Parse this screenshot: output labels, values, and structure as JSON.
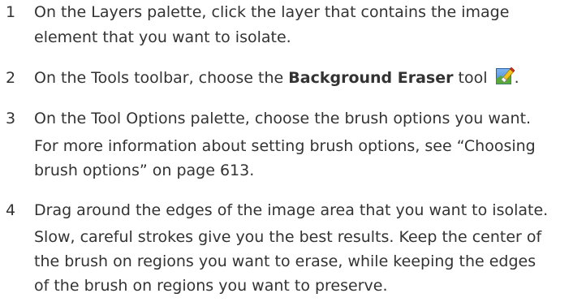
{
  "steps": [
    {
      "number": "1",
      "lines": [
        "On the Layers palette, click the layer that contains the image",
        "element that you want to isolate."
      ]
    },
    {
      "number": "2",
      "prefix": "On the Tools toolbar, choose the ",
      "bold": "Background Eraser",
      "suffix": " tool ",
      "end": ".",
      "icon": "background-eraser-icon"
    },
    {
      "number": "3",
      "lines": [
        "On the Tool Options palette, choose the brush options you want.",
        "For more information about setting brush options, see “Choosing",
        "brush options” on page 613."
      ]
    },
    {
      "number": "4",
      "lines": [
        "Drag around the edges of the image area that you want to isolate.",
        "Slow, careful strokes give you the best results. Keep the center of",
        "the brush on regions you want to erase, while keeping the edges",
        "of the brush on regions you want to preserve."
      ]
    }
  ]
}
